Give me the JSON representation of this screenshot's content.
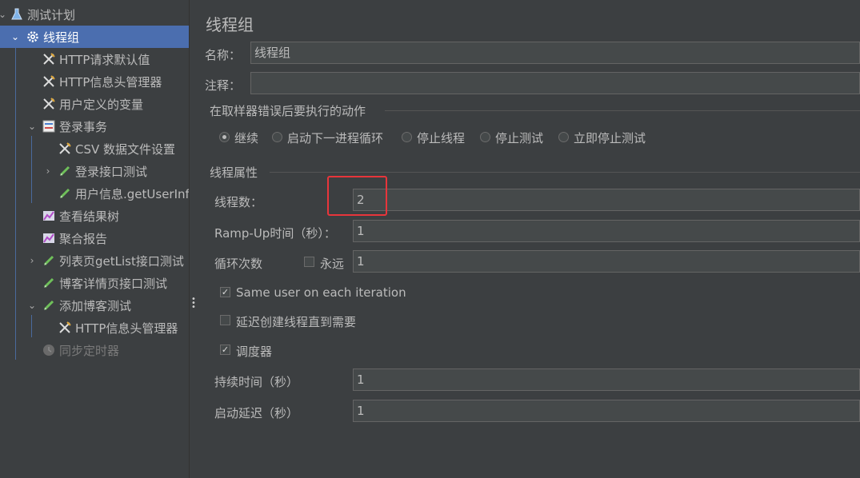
{
  "tree": {
    "items": [
      {
        "label": "测试计划"
      },
      {
        "label": "线程组"
      },
      {
        "label": "HTTP请求默认值"
      },
      {
        "label": "HTTP信息头管理器"
      },
      {
        "label": "用户定义的变量"
      },
      {
        "label": "登录事务"
      },
      {
        "label": "CSV 数据文件设置"
      },
      {
        "label": "登录接口测试"
      },
      {
        "label": "用户信息.getUserInfo"
      },
      {
        "label": "查看结果树"
      },
      {
        "label": "聚合报告"
      },
      {
        "label": "列表页getList接口测试"
      },
      {
        "label": "博客详情页接口测试"
      },
      {
        "label": "添加博客测试"
      },
      {
        "label": "HTTP信息头管理器"
      },
      {
        "label": "同步定时器"
      }
    ]
  },
  "panel": {
    "title": "线程组",
    "name_label": "名称：",
    "name_value": "线程组",
    "comment_label": "注释：",
    "comment_value": "",
    "error_section": "在取样器错误后要执行的动作",
    "error_options": [
      "继续",
      "启动下一进程循环",
      "停止线程",
      "停止测试",
      "立即停止测试"
    ],
    "selected_error_option": "继续",
    "thread_section": "线程属性",
    "threads_label": "线程数：",
    "threads_value": "2",
    "rampup_label": "Ramp-Up时间（秒）：",
    "rampup_value": "1",
    "loop_label": "循环次数",
    "forever_label": "永远",
    "forever_checked": false,
    "loop_value": "1",
    "same_user_label": "Same user on each iteration",
    "same_user_checked": true,
    "delay_create_label": "延迟创建线程直到需要",
    "delay_create_checked": false,
    "scheduler_label": "调度器",
    "scheduler_checked": true,
    "duration_label": "持续时间（秒）",
    "duration_value": "1",
    "startup_delay_label": "启动延迟（秒）",
    "startup_delay_value": "1"
  },
  "colors": {
    "background": "#3c3f41",
    "selection": "#4b6eaf",
    "highlight_box": "#e8353b"
  }
}
